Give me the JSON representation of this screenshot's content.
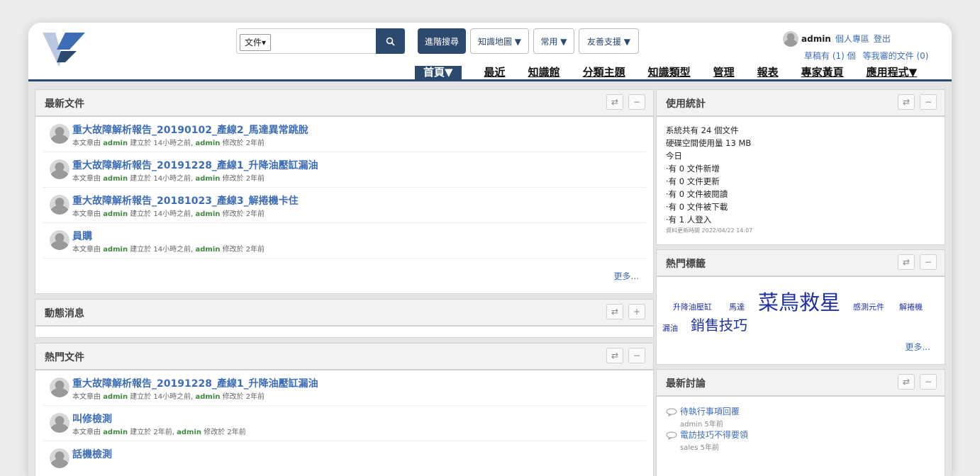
{
  "header": {
    "search": {
      "scope": "文件",
      "placeholder": "",
      "value": ""
    },
    "buttons": {
      "advanced": "進階搜尋",
      "knowledge_map": "知識地圖 ▼",
      "common": "常用 ▼",
      "friendly": "友善支援 ▼"
    },
    "user": {
      "name": "admin",
      "personal": "個人專區",
      "logout": "登出",
      "drafts": "草稿有 (1) 個",
      "pending": "等我審的文件 (0)"
    },
    "nav": [
      "首頁▼",
      "最近",
      "知識館",
      "分類主題",
      "知識類型",
      "管理",
      "報表",
      "專家黃頁",
      "應用程式▼"
    ]
  },
  "latest_docs": {
    "title": "最新文件",
    "more": "更多...",
    "items": [
      {
        "title": "重大故障解析報告_20190102_產線2_馬達異常跳脫",
        "meta_pre": "本文章由 ",
        "creator": "admin",
        "meta_mid": " 建立於 14小時之前, ",
        "editor": "admin",
        "meta_post": " 修改於 2年前"
      },
      {
        "title": "重大故障解析報告_20191228_產線1_升降油壓缸漏油",
        "meta_pre": "本文章由 ",
        "creator": "admin",
        "meta_mid": " 建立於 14小時之前, ",
        "editor": "admin",
        "meta_post": " 修改於 2年前"
      },
      {
        "title": "重大故障解析報告_20181023_產線3_解捲機卡住",
        "meta_pre": "本文章由 ",
        "creator": "admin",
        "meta_mid": " 建立於 14小時之前, ",
        "editor": "admin",
        "meta_post": " 修改於 2年前"
      },
      {
        "title": "員購",
        "meta_pre": "本文章由 ",
        "creator": "admin",
        "meta_mid": " 建立於 14小時之前, ",
        "editor": "admin",
        "meta_post": " 修改於 2年前"
      }
    ]
  },
  "news": {
    "title": "動態消息"
  },
  "hot_docs": {
    "title": "熱門文件",
    "items": [
      {
        "title": "重大故障解析報告_20191228_產線1_升降油壓缸漏油",
        "meta_pre": "本文章由 ",
        "creator": "admin",
        "meta_mid": " 建立於 14小時之前, ",
        "editor": "admin",
        "meta_post": " 修改於 2年前"
      },
      {
        "title": "叫修檢測",
        "meta_pre": "本文章由 ",
        "creator": "admin",
        "meta_mid": " 建立於 2年前, ",
        "editor": "admin",
        "meta_post": " 修改於 2年前"
      },
      {
        "title": "話機檢測"
      }
    ]
  },
  "usage": {
    "title": "使用統計",
    "lines": [
      "系統共有 24 個文件",
      "硬碟空間使用量 13 MB",
      "今日",
      "‧有 0 文件新增",
      "‧有 0 文件更新",
      "‧有 0 文件被閱讀",
      "‧有 0 文件被下載",
      "‧有 1 人登入"
    ],
    "updated": "資料更新時間 2022/04/22 14:07"
  },
  "hot_tags": {
    "title": "熱門標籤",
    "tags": [
      "升降油壓缸",
      "馬達",
      "菜鳥救星",
      "感測元件",
      "解捲機",
      "漏油",
      "銷售技巧"
    ],
    "more": "更多..."
  },
  "discussions": {
    "title": "最新討論",
    "items": [
      {
        "title": "待執行事項回覆",
        "meta": "admin 5年前"
      },
      {
        "title": "電訪技巧不得要領",
        "meta": "sales 5年前"
      }
    ]
  },
  "icons": {
    "refresh": "⇄",
    "minimize": "−",
    "add": "+"
  }
}
